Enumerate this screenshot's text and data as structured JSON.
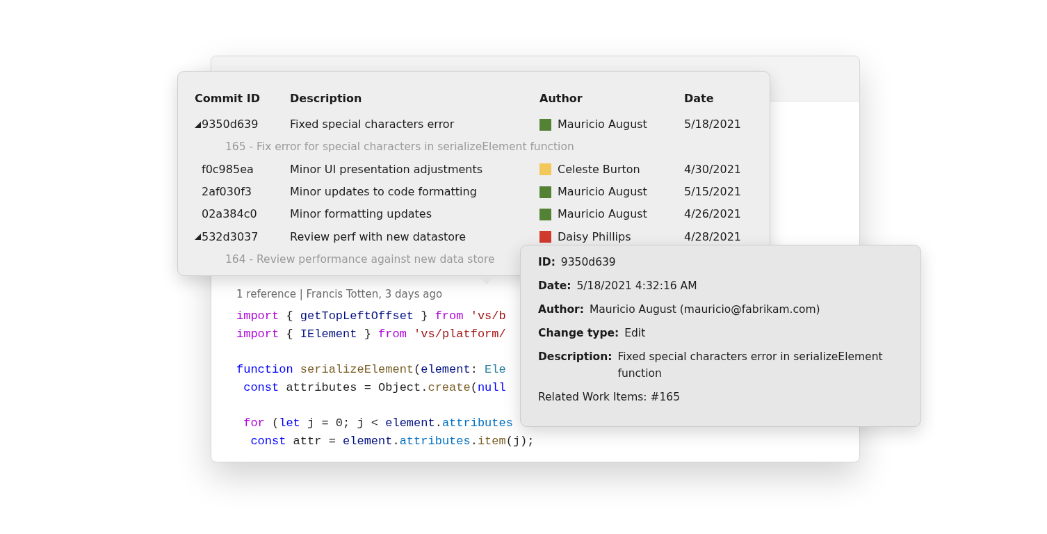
{
  "editor": {
    "code_lens": "1 reference | Francis Totten, 3 days ago",
    "lines": [
      {
        "kind": "code",
        "tokens": [
          {
            "kind": "control",
            "text": "import"
          },
          {
            "kind": "plain",
            "text": " { "
          },
          {
            "kind": "variable",
            "text": "getTopLeftOffset"
          },
          {
            "kind": "plain",
            "text": " } "
          },
          {
            "kind": "control",
            "text": "from"
          },
          {
            "kind": "string",
            "text": " 'vs/b"
          }
        ]
      },
      {
        "kind": "code",
        "tokens": [
          {
            "kind": "control",
            "text": "import"
          },
          {
            "kind": "plain",
            "text": " { "
          },
          {
            "kind": "variable",
            "text": "IElement"
          },
          {
            "kind": "plain",
            "text": " } "
          },
          {
            "kind": "control",
            "text": "from"
          },
          {
            "kind": "string",
            "text": " 'vs/platform/"
          }
        ]
      },
      {
        "kind": "blank"
      },
      {
        "kind": "code",
        "tokens": [
          {
            "kind": "keyword",
            "text": "function"
          },
          {
            "kind": "function",
            "text": " serializeElement"
          },
          {
            "kind": "plain",
            "text": "("
          },
          {
            "kind": "variable",
            "text": "element"
          },
          {
            "kind": "plain",
            "text": ": "
          },
          {
            "kind": "type",
            "text": "Ele"
          }
        ]
      },
      {
        "kind": "code",
        "tokens": [
          {
            "kind": "keyword",
            "text": " const"
          },
          {
            "kind": "plain",
            "text": " attributes = Object."
          },
          {
            "kind": "function",
            "text": "create"
          },
          {
            "kind": "plain",
            "text": "("
          },
          {
            "kind": "keyword",
            "text": "null"
          }
        ]
      },
      {
        "kind": "blank"
      },
      {
        "kind": "code",
        "tokens": [
          {
            "kind": "control",
            "text": " for"
          },
          {
            "kind": "plain",
            "text": " ("
          },
          {
            "kind": "keyword",
            "text": "let"
          },
          {
            "kind": "plain",
            "text": " j = 0; j < "
          },
          {
            "kind": "variable",
            "text": "element"
          },
          {
            "kind": "plain",
            "text": "."
          },
          {
            "kind": "property",
            "text": "attributes"
          }
        ]
      },
      {
        "kind": "code",
        "tokens": [
          {
            "kind": "keyword",
            "text": "  const"
          },
          {
            "kind": "plain",
            "text": " attr = "
          },
          {
            "kind": "variable",
            "text": "element"
          },
          {
            "kind": "plain",
            "text": "."
          },
          {
            "kind": "property",
            "text": "attributes"
          },
          {
            "kind": "plain",
            "text": "."
          },
          {
            "kind": "function",
            "text": "item"
          },
          {
            "kind": "plain",
            "text": "(j);"
          }
        ]
      }
    ]
  },
  "commits_popup": {
    "columns": [
      "Commit ID",
      "Description",
      "Author",
      "Date"
    ],
    "rows": [
      {
        "id": "9350d639",
        "description": "Fixed special characters error",
        "author": "Mauricio August",
        "color": "#548235",
        "date": "5/18/2021",
        "expanded": true,
        "children": [
          {
            "text": "165 - Fix error for special characters in serializeElement function"
          }
        ]
      },
      {
        "id": "f0c985ea",
        "description": "Minor UI presentation adjustments",
        "author": "Celeste Burton",
        "color": "#f2c85b",
        "date": "4/30/2021"
      },
      {
        "id": "2af030f3",
        "description": "Minor updates to code formatting",
        "author": "Mauricio August",
        "color": "#548235",
        "date": "5/15/2021"
      },
      {
        "id": "02a384c0",
        "description": "Minor formatting updates",
        "author": "Mauricio August",
        "color": "#548235",
        "date": "4/26/2021"
      },
      {
        "id": "532d3037",
        "description": "Review perf with new datastore",
        "author": "Daisy Phillips",
        "color": "#d13b2e",
        "date": "4/28/2021",
        "expanded": true,
        "children": [
          {
            "text": "164 - Review performance against new data store"
          }
        ]
      }
    ]
  },
  "details_tooltip": {
    "fields": [
      {
        "kind": "field",
        "label": "ID:",
        "value": "9350d639"
      },
      {
        "kind": "field",
        "label": "Date:",
        "value": "5/18/2021 4:32:16 AM"
      },
      {
        "kind": "field",
        "label": "Author:",
        "value": "Mauricio August (mauricio@fabrikam.com)"
      },
      {
        "kind": "field",
        "label": "Change type:",
        "value": "Edit"
      },
      {
        "kind": "field",
        "label": "Description:",
        "value": "Fixed special characters error in serializeElement function"
      },
      {
        "kind": "note",
        "text": "Related Work Items: #165"
      }
    ]
  }
}
